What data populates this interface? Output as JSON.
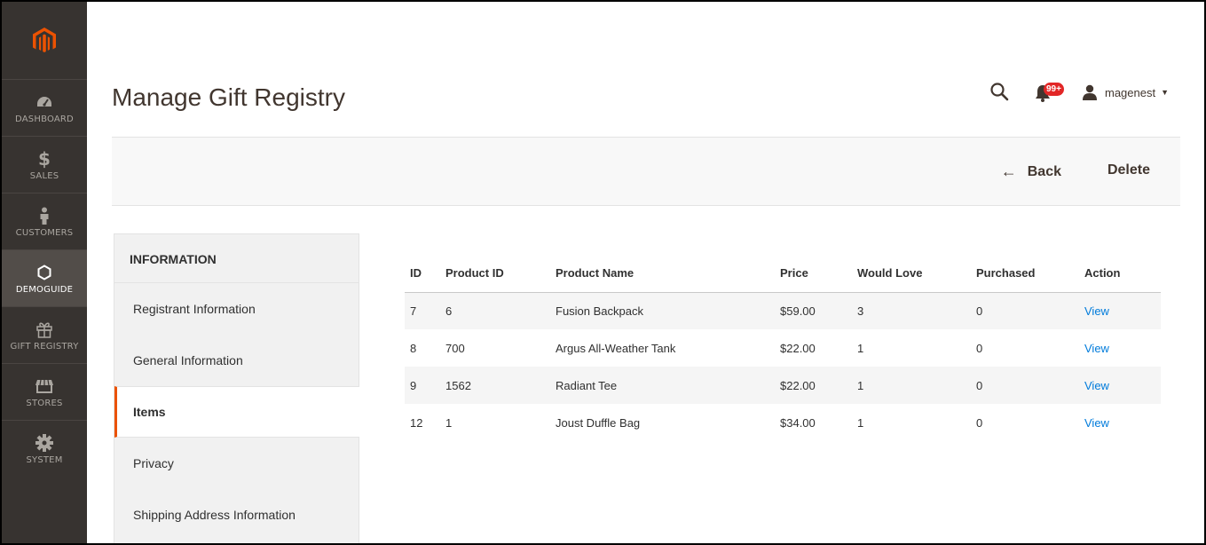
{
  "sidebar": {
    "items": [
      {
        "label": "DASHBOARD",
        "icon": "dashboard-icon"
      },
      {
        "label": "SALES",
        "icon": "dollar-icon"
      },
      {
        "label": "CUSTOMERS",
        "icon": "person-icon"
      },
      {
        "label": "DEMOGUIDE",
        "icon": "hexagon-icon",
        "active": true
      },
      {
        "label": "GIFT REGISTRY",
        "icon": "gift-icon"
      },
      {
        "label": "STORES",
        "icon": "store-icon"
      },
      {
        "label": "SYSTEM",
        "icon": "gear-icon"
      }
    ],
    "logo_color": "#eb5202"
  },
  "header": {
    "title": "Manage Gift Registry",
    "notifications_count": "99+",
    "username": "magenest"
  },
  "actions": {
    "back_label": "Back",
    "delete_label": "Delete"
  },
  "tabs": {
    "title": "INFORMATION",
    "items": [
      {
        "label": "Registrant Information"
      },
      {
        "label": "General Information"
      },
      {
        "label": "Items",
        "active": true
      },
      {
        "label": "Privacy"
      },
      {
        "label": "Shipping Address Information"
      }
    ],
    "active_color": "#eb5202"
  },
  "grid": {
    "columns": [
      "ID",
      "Product ID",
      "Product Name",
      "Price",
      "Would Love",
      "Purchased",
      "Action"
    ],
    "rows": [
      {
        "id": "7",
        "product_id": "6",
        "name": "Fusion Backpack",
        "price": "$59.00",
        "would_love": "3",
        "purchased": "0",
        "action": "View"
      },
      {
        "id": "8",
        "product_id": "700",
        "name": "Argus All-Weather Tank",
        "price": "$22.00",
        "would_love": "1",
        "purchased": "0",
        "action": "View"
      },
      {
        "id": "9",
        "product_id": "1562",
        "name": "Radiant Tee",
        "price": "$22.00",
        "would_love": "1",
        "purchased": "0",
        "action": "View"
      },
      {
        "id": "12",
        "product_id": "1",
        "name": "Joust Duffle Bag",
        "price": "$34.00",
        "would_love": "1",
        "purchased": "0",
        "action": "View"
      }
    ],
    "link_color": "#007bdb"
  }
}
